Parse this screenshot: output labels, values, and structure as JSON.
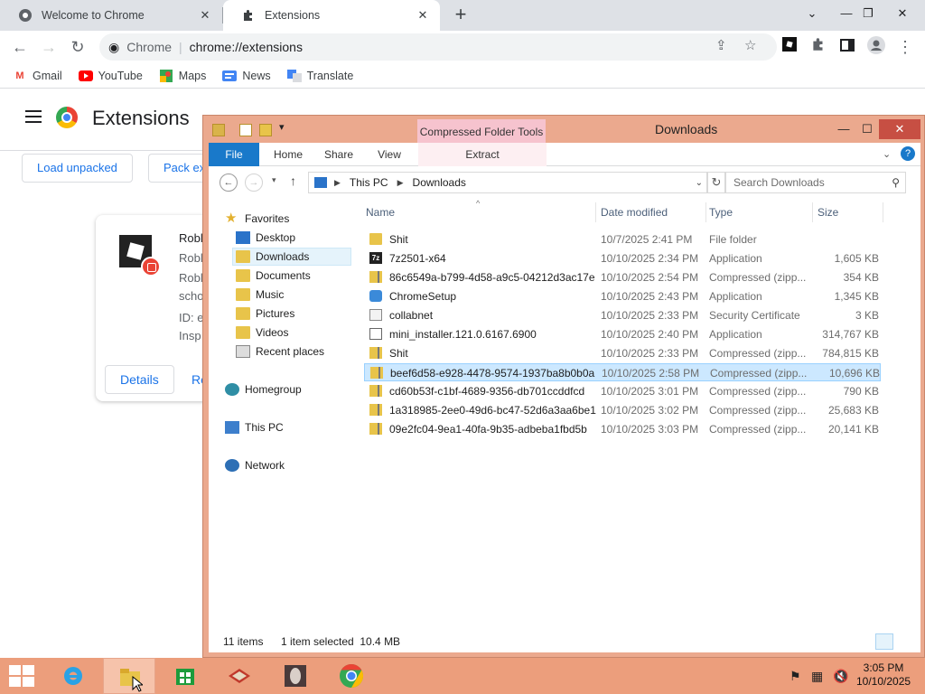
{
  "chrome": {
    "tabs": [
      {
        "label": "Welcome to Chrome",
        "icon": "chrome-icon"
      },
      {
        "label": "Extensions",
        "icon": "puzzle-icon"
      }
    ],
    "omnibox": {
      "site": "Chrome",
      "url": "chrome://extensions"
    },
    "bookmarks": [
      {
        "label": "Gmail",
        "icon": "gmail-icon",
        "color": "#ea4335"
      },
      {
        "label": "YouTube",
        "icon": "youtube-icon",
        "color": "#ff0000"
      },
      {
        "label": "Maps",
        "icon": "maps-icon",
        "color": "#34a853"
      },
      {
        "label": "News",
        "icon": "news-icon",
        "color": "#4285f4"
      },
      {
        "label": "Translate",
        "icon": "translate-icon",
        "color": "#4285f4"
      }
    ]
  },
  "extensions_page": {
    "title": "Extensions",
    "load_unpacked": "Load unpacked",
    "pack_extension": "Pack ex",
    "card": {
      "lines": [
        "Robl",
        "Robl",
        "Robl",
        "scho",
        "ID: e",
        "Insp"
      ],
      "details": "Details",
      "remove": "Re"
    }
  },
  "explorer": {
    "title": "Downloads",
    "context_tab": "Compressed Folder Tools",
    "ribbon_tabs": [
      "File",
      "Home",
      "Share",
      "View",
      "Extract"
    ],
    "breadcrumb": [
      "This PC",
      "Downloads"
    ],
    "search_placeholder": "Search Downloads",
    "nav": [
      {
        "label": "Favorites",
        "icon": "star-icon"
      },
      {
        "label": "Desktop",
        "icon": "desktop-icon"
      },
      {
        "label": "Downloads",
        "icon": "downloads-folder-icon",
        "selected": true
      },
      {
        "label": "Documents",
        "icon": "folder-icon"
      },
      {
        "label": "Music",
        "icon": "folder-icon"
      },
      {
        "label": "Pictures",
        "icon": "folder-icon"
      },
      {
        "label": "Videos",
        "icon": "folder-icon"
      },
      {
        "label": "Recent places",
        "icon": "recent-places-icon"
      },
      {
        "label": "Homegroup",
        "icon": "homegroup-icon"
      },
      {
        "label": "This PC",
        "icon": "pc-icon"
      },
      {
        "label": "Network",
        "icon": "network-icon"
      }
    ],
    "columns": [
      "Name",
      "Date modified",
      "Type",
      "Size"
    ],
    "files": [
      {
        "name": "Shit",
        "date": "10/7/2025 2:41 PM",
        "type": "File folder",
        "size": "",
        "icon": "folder"
      },
      {
        "name": "7z2501-x64",
        "date": "10/10/2025 2:34 PM",
        "type": "Application",
        "size": "1,605 KB",
        "icon": "app7z"
      },
      {
        "name": "86c6549a-b799-4d58-a9c5-04212d3ac17e",
        "date": "10/10/2025 2:54 PM",
        "type": "Compressed (zipp...",
        "size": "354 KB",
        "icon": "zip"
      },
      {
        "name": "ChromeSetup",
        "date": "10/10/2025 2:43 PM",
        "type": "Application",
        "size": "1,345 KB",
        "icon": "setup"
      },
      {
        "name": "collabnet",
        "date": "10/10/2025 2:33 PM",
        "type": "Security Certificate",
        "size": "3 KB",
        "icon": "cert"
      },
      {
        "name": "mini_installer.121.0.6167.6900",
        "date": "10/10/2025 2:40 PM",
        "type": "Application",
        "size": "314,767 KB",
        "icon": "inst"
      },
      {
        "name": "Shit",
        "date": "10/10/2025 2:33 PM",
        "type": "Compressed (zipp...",
        "size": "784,815 KB",
        "icon": "zip"
      },
      {
        "name": "beef6d58-e928-4478-9574-1937ba8b0b0a",
        "date": "10/10/2025 2:58 PM",
        "type": "Compressed (zipp...",
        "size": "10,696 KB",
        "icon": "zip",
        "selected": true
      },
      {
        "name": "cd60b53f-c1bf-4689-9356-db701ccddfcd",
        "date": "10/10/2025 3:01 PM",
        "type": "Compressed (zipp...",
        "size": "790 KB",
        "icon": "zip"
      },
      {
        "name": "1a318985-2ee0-49d6-bc47-52d6a3aa6be1",
        "date": "10/10/2025 3:02 PM",
        "type": "Compressed (zipp...",
        "size": "25,683 KB",
        "icon": "zip"
      },
      {
        "name": "09e2fc04-9ea1-40fa-9b35-adbeba1fbd5b",
        "date": "10/10/2025 3:03 PM",
        "type": "Compressed (zipp...",
        "size": "20,141 KB",
        "icon": "zip"
      }
    ],
    "status": {
      "count": "11 items",
      "selection": "1 item selected  10.4 MB"
    }
  },
  "taskbar": {
    "time": "3:05 PM",
    "date": "10/10/2025",
    "apps": [
      "internet-explorer-icon",
      "file-explorer-icon",
      "store-icon",
      "app-icon",
      "media-app-icon",
      "chrome-icon"
    ]
  }
}
